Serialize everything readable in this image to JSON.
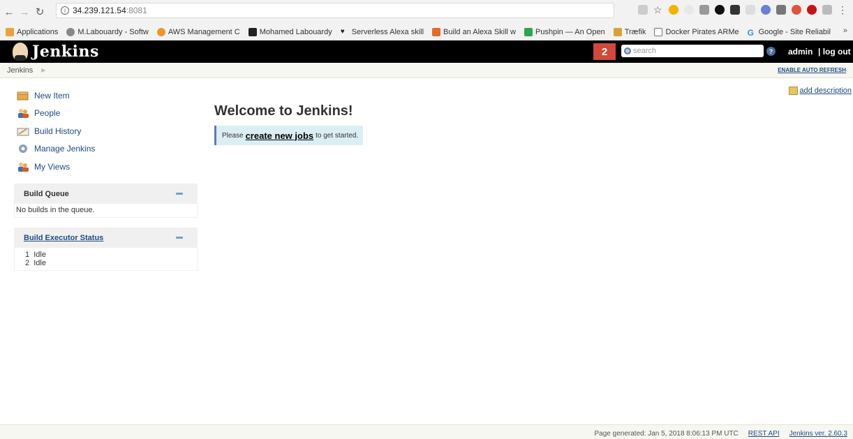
{
  "browser": {
    "url_host": "34.239.121.54",
    "url_port": ":8081",
    "bookmarks": [
      {
        "label": "Applications",
        "color": "#e8a33c"
      },
      {
        "label": "M.Labouardy - Softw",
        "color": "#888888"
      },
      {
        "label": "AWS Management C",
        "color": "#f0962a"
      },
      {
        "label": "Mohamed Labouardy",
        "color": "#222222"
      },
      {
        "label": "Serverless Alexa skill",
        "color": "#222222"
      },
      {
        "label": "Build an Alexa Skill w",
        "color": "#e36b2c"
      },
      {
        "label": "Pushpin — An Open",
        "color": "#2da44e"
      },
      {
        "label": "Træfik",
        "color": "#d8a236"
      },
      {
        "label": "Docker Pirates ARMe",
        "color": "#777777"
      },
      {
        "label": "Google - Site Reliabil",
        "color": "#4285f4"
      }
    ],
    "more": "»"
  },
  "header": {
    "title": "Jenkins",
    "badge_count": "2",
    "search_placeholder": "search",
    "help": "?",
    "user": "admin",
    "logout": "| log out"
  },
  "breadcrumb": {
    "root": "Jenkins",
    "auto_refresh": "ENABLE AUTO REFRESH"
  },
  "sidebar": {
    "tasks": [
      {
        "label": "New Item",
        "icon": "new-item-icon"
      },
      {
        "label": "People",
        "icon": "people-icon"
      },
      {
        "label": "Build History",
        "icon": "build-history-icon"
      },
      {
        "label": "Manage Jenkins",
        "icon": "gear-icon"
      },
      {
        "label": "My Views",
        "icon": "views-icon"
      }
    ],
    "build_queue": {
      "title": "Build Queue",
      "empty": "No builds in the queue."
    },
    "executors": {
      "title": "Build Executor Status",
      "rows": [
        {
          "num": "1",
          "status": "Idle"
        },
        {
          "num": "2",
          "status": "Idle"
        }
      ]
    }
  },
  "main": {
    "welcome": "Welcome to Jenkins!",
    "notice_pre": "Please",
    "notice_link": "create new jobs",
    "notice_post": "to get started.",
    "add_description": "add description"
  },
  "footer": {
    "generated": "Page generated: Jan 5, 2018 8:06:13 PM UTC",
    "rest_api": "REST API",
    "version": "Jenkins ver. 2.60.3"
  }
}
